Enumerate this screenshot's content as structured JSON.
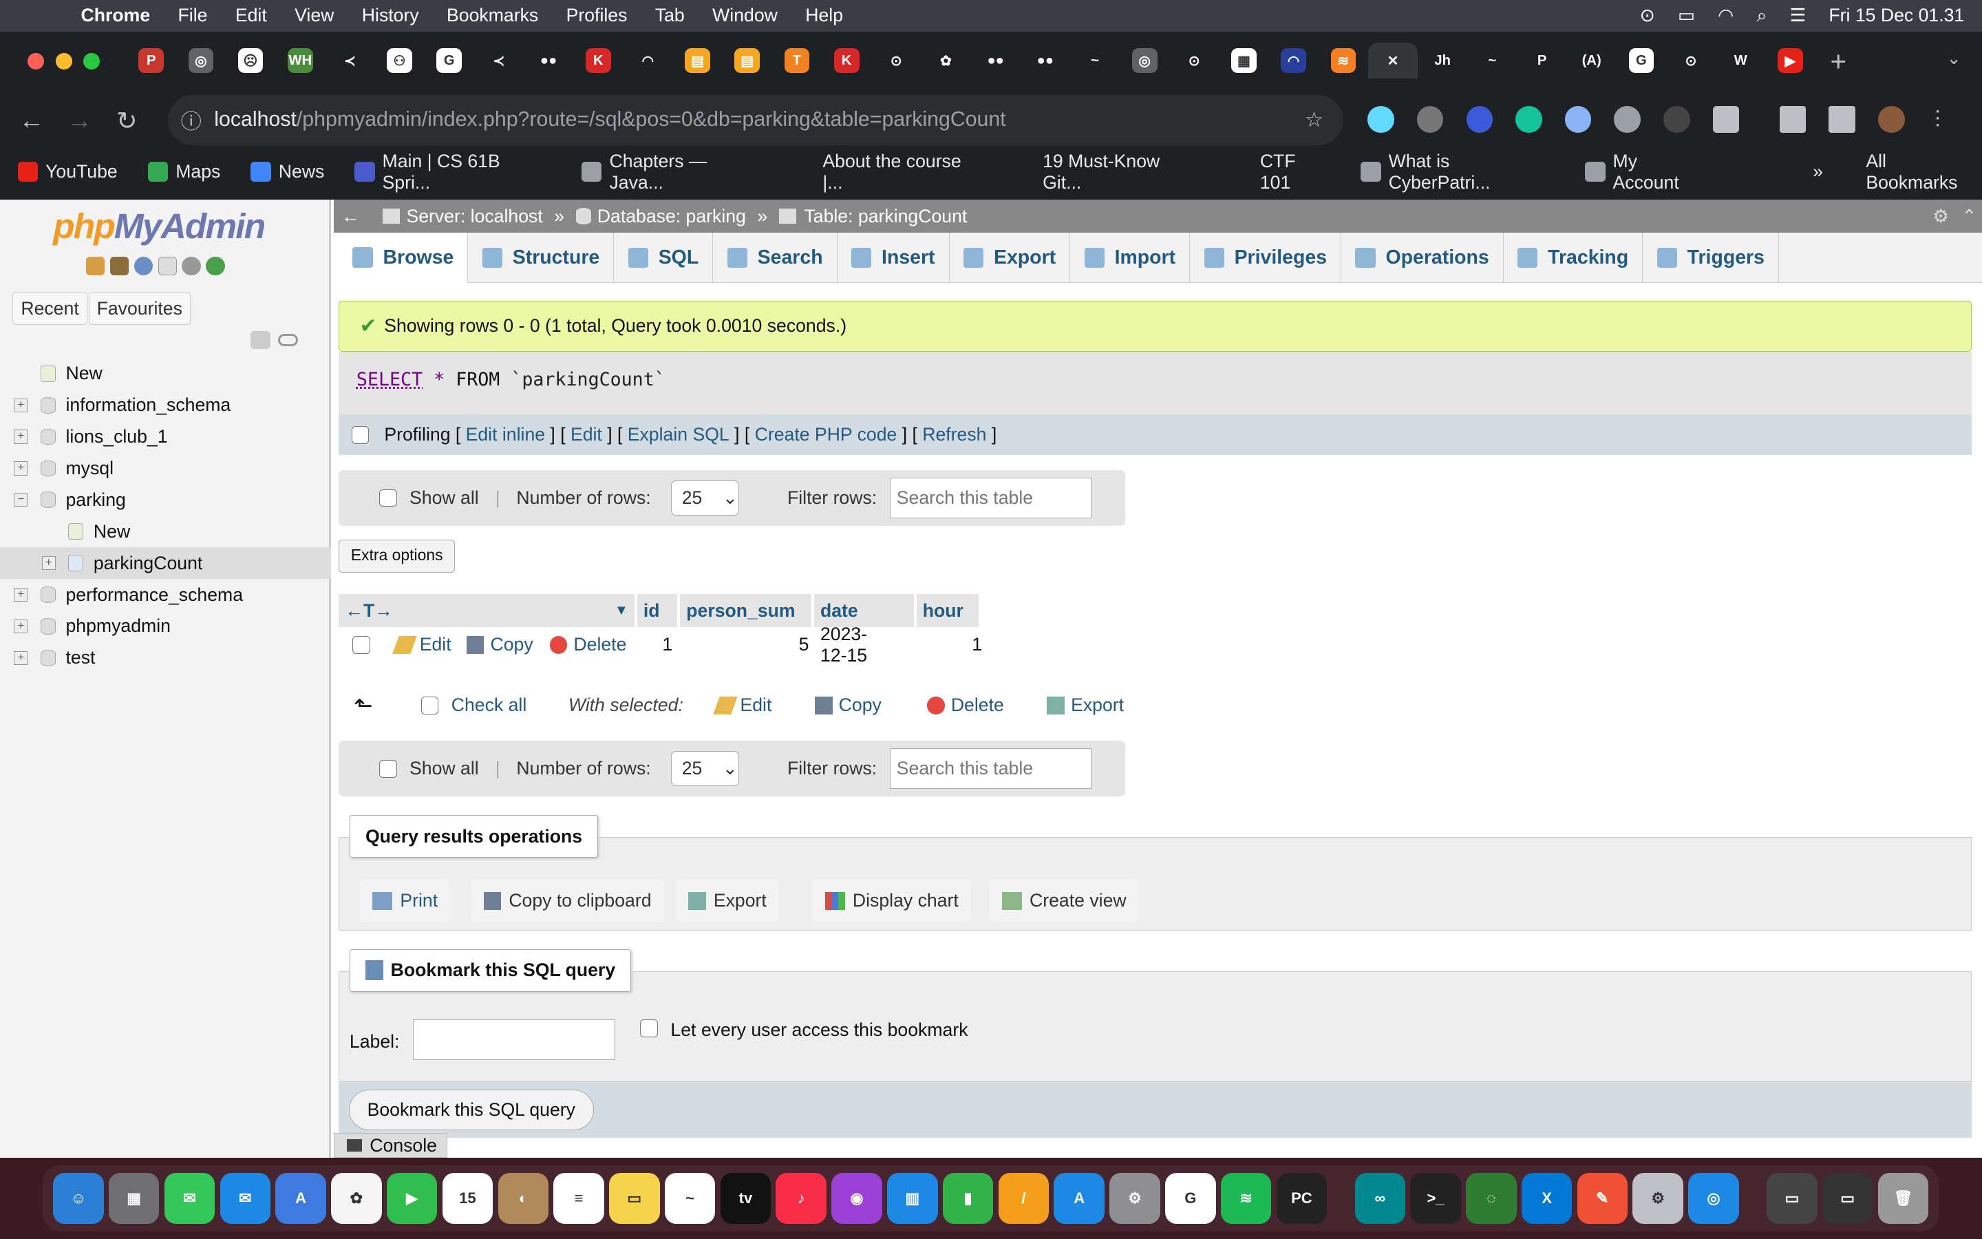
{
  "menubar": {
    "app": "Chrome",
    "items": [
      "File",
      "Edit",
      "View",
      "History",
      "Bookmarks",
      "Profiles",
      "Tab",
      "Window",
      "Help"
    ],
    "clock": "Fri 15 Dec  01.31"
  },
  "browser": {
    "url_host": "localhost",
    "url_path": "/phpmyadmin/index.php?route=/sql&pos=0&db=parking&table=parkingCount",
    "tabs": [
      {
        "c": "#c8372d",
        "t": "P"
      },
      {
        "c": "#5f6368",
        "t": "◎"
      },
      {
        "c": "#fff",
        "t": "☹"
      },
      {
        "c": "#4a8c3b",
        "t": "WH"
      },
      {
        "c": "#1f2023",
        "t": "≺"
      },
      {
        "c": "#fff",
        "t": "⚇"
      },
      {
        "c": "#fff",
        "t": "G"
      },
      {
        "c": "#1f2023",
        "t": "≺"
      },
      {
        "c": "#1f2023",
        "t": "●●"
      },
      {
        "c": "#d62828",
        "t": "K"
      },
      {
        "c": "#1f2023",
        "t": "◠"
      },
      {
        "c": "#f5a623",
        "t": "▤"
      },
      {
        "c": "#f5a623",
        "t": "▤"
      },
      {
        "c": "#f58220",
        "t": "T"
      },
      {
        "c": "#d62828",
        "t": "K"
      },
      {
        "c": "#1f2023",
        "t": "⊙"
      },
      {
        "c": "#1f2023",
        "t": "✿"
      },
      {
        "c": "#1f2023",
        "t": "●●"
      },
      {
        "c": "#1f2023",
        "t": "●●"
      },
      {
        "c": "#1f2023",
        "t": "~"
      },
      {
        "c": "#5f6368",
        "t": "◎"
      },
      {
        "c": "#1f2023",
        "t": "⊙"
      },
      {
        "c": "#fff",
        "t": "▦"
      },
      {
        "c": "#2a3f9c",
        "t": "◠"
      },
      {
        "c": "#f48024",
        "t": "≋"
      },
      {
        "c": "#35363a",
        "t": "✕"
      },
      {
        "c": "#1f2023",
        "t": "Jh"
      },
      {
        "c": "#1f2023",
        "t": "~"
      },
      {
        "c": "#1f2023",
        "t": "P"
      },
      {
        "c": "#1f2023",
        "t": "(A)"
      },
      {
        "c": "#fff",
        "t": "G"
      },
      {
        "c": "#1f2023",
        "t": "⊙"
      },
      {
        "c": "#1f2023",
        "t": "W"
      },
      {
        "c": "#e62117",
        "t": "▶"
      }
    ],
    "bookmarks": [
      {
        "c": "#e62117",
        "t": "YouTube"
      },
      {
        "c": "#34a853",
        "t": "Maps"
      },
      {
        "c": "#4285f4",
        "t": "News"
      },
      {
        "c": "#4b5bcc",
        "t": "Main | CS 61B Spri..."
      },
      {
        "c": "#9aa0a6",
        "t": "Chapters — Java..."
      },
      {
        "c": "#1f2023",
        "t": "About the course |..."
      },
      {
        "c": "#1f2023",
        "t": "19 Must-Know Git..."
      },
      {
        "c": "#1f2023",
        "t": "CTF 101"
      },
      {
        "c": "#9aa0a6",
        "t": "What is CyberPatri..."
      },
      {
        "c": "#9aa0a6",
        "t": "My Account"
      }
    ],
    "more": "»",
    "all_bookmarks": "All Bookmarks"
  },
  "pma": {
    "logo_php": "php",
    "logo_rest": "MyAdmin",
    "recent": "Recent",
    "favourites": "Favourites",
    "tree": [
      {
        "label": "New",
        "level": 0,
        "pm": ""
      },
      {
        "label": "information_schema",
        "level": 0,
        "pm": "+"
      },
      {
        "label": "lions_club_1",
        "level": 0,
        "pm": "+"
      },
      {
        "label": "mysql",
        "level": 0,
        "pm": "+"
      },
      {
        "label": "parking",
        "level": 0,
        "pm": "−"
      },
      {
        "label": "New",
        "level": 1,
        "pm": ""
      },
      {
        "label": "parkingCount",
        "level": 1,
        "pm": "+"
      },
      {
        "label": "performance_schema",
        "level": 0,
        "pm": "+"
      },
      {
        "label": "phpmyadmin",
        "level": 0,
        "pm": "+"
      },
      {
        "label": "test",
        "level": 0,
        "pm": "+"
      }
    ],
    "crumb": {
      "server": "Server: localhost",
      "database": "Database: parking",
      "table": "Table: parkingCount",
      "sep": "»"
    },
    "tabs": [
      "Browse",
      "Structure",
      "SQL",
      "Search",
      "Insert",
      "Export",
      "Import",
      "Privileges",
      "Operations",
      "Tracking",
      "Triggers"
    ],
    "success": "Showing rows 0 - 0 (1 total, Query took 0.0010 seconds.)",
    "sql": {
      "kw": "SELECT",
      "star": "*",
      "from": "FROM",
      "table": "`parkingCount`"
    },
    "profiling": {
      "label": "Profiling",
      "links": [
        "Edit inline",
        "Edit",
        "Explain SQL",
        "Create PHP code",
        "Refresh"
      ]
    },
    "nav": {
      "show_all": "Show all",
      "rows_label": "Number of rows:",
      "rows_value": "25",
      "filter_label": "Filter rows:",
      "filter_placeholder": "Search this table"
    },
    "extra_options": "Extra options",
    "table": {
      "columns": [
        "id",
        "person_sum",
        "date",
        "hour"
      ],
      "rows": [
        {
          "id": "1",
          "person_sum": "5",
          "date": "2023-12-15",
          "hour": "1"
        }
      ],
      "edit": "Edit",
      "copy": "Copy",
      "delete": "Delete"
    },
    "bulk": {
      "check_all": "Check all",
      "with_selected": "With selected:",
      "edit": "Edit",
      "copy": "Copy",
      "delete": "Delete",
      "export": "Export"
    },
    "qro": {
      "legend": "Query results operations",
      "buttons": [
        "Print",
        "Copy to clipboard",
        "Export",
        "Display chart",
        "Create view"
      ]
    },
    "bookmark": {
      "legend": "Bookmark this SQL query",
      "label": "Label:",
      "check": "Let every user access this bookmark",
      "submit": "Bookmark this SQL query"
    },
    "console": "Console"
  },
  "dock": [
    {
      "c": "#2b7fd6",
      "t": "☺"
    },
    {
      "c": "#6e6e73",
      "t": "▦"
    },
    {
      "c": "#34c759",
      "t": "✉"
    },
    {
      "c": "#1e88e5",
      "t": "✉"
    },
    {
      "c": "#3d7be0",
      "t": "A"
    },
    {
      "c": "#f5f5f5",
      "t": "✿"
    },
    {
      "c": "#2fbd4d",
      "t": "▶"
    },
    {
      "c": "#fff",
      "t": "15"
    },
    {
      "c": "#b08a5a",
      "t": "◐"
    },
    {
      "c": "#fff",
      "t": "≡"
    },
    {
      "c": "#f5d34a",
      "t": "▭"
    },
    {
      "c": "#fff",
      "t": "~"
    },
    {
      "c": "#111",
      "t": "tv"
    },
    {
      "c": "#fa2d48",
      "t": "♪"
    },
    {
      "c": "#9b3fd6",
      "t": "◉"
    },
    {
      "c": "#1e88e5",
      "t": "▥"
    },
    {
      "c": "#32b34a",
      "t": "▮"
    },
    {
      "c": "#f59e1b",
      "t": "/"
    },
    {
      "c": "#1e88e5",
      "t": "A"
    },
    {
      "c": "#8e8e93",
      "t": "⚙"
    },
    {
      "c": "#fff",
      "t": "G"
    },
    {
      "c": "#1db954",
      "t": "≋"
    },
    {
      "c": "#222",
      "t": "PC"
    },
    {
      "c": "#00878f",
      "t": "∞"
    },
    {
      "c": "#222",
      "t": ">_"
    },
    {
      "c": "#2e7d32",
      "t": "◌"
    },
    {
      "c": "#0078d4",
      "t": "X"
    },
    {
      "c": "#f05033",
      "t": "✎"
    },
    {
      "c": "#c0c0c8",
      "t": "⚙"
    },
    {
      "c": "#1e88e5",
      "t": "◎"
    },
    {
      "c": "#444",
      "t": "▭"
    },
    {
      "c": "#333",
      "t": "▭"
    },
    {
      "c": "#999",
      "t": "🗑"
    }
  ]
}
